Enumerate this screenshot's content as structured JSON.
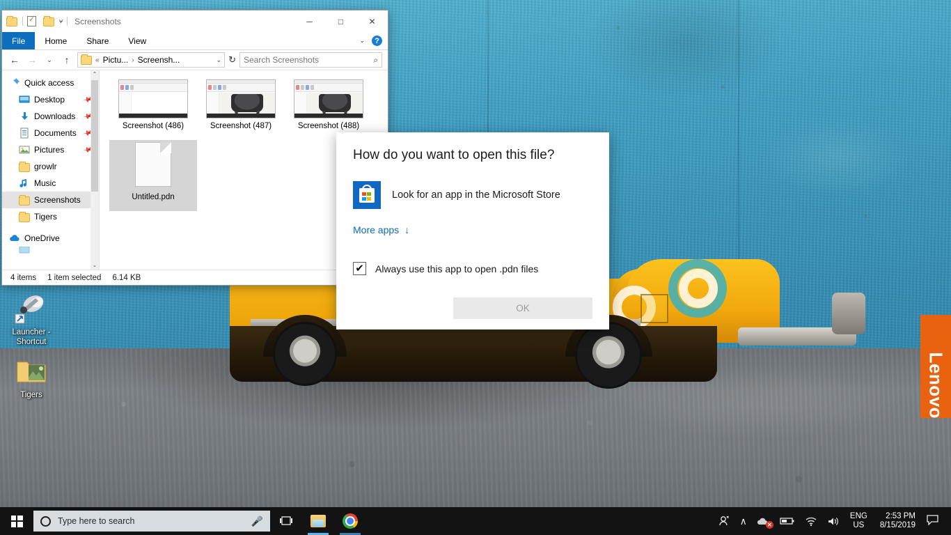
{
  "desktop": {
    "icons": [
      {
        "label": "Launcher - Shortcut",
        "icon": "launcher-shortcut-icon"
      },
      {
        "label": "Tigers",
        "icon": "folder-picture-icon"
      }
    ],
    "lenovo_banner": "Lenovo",
    "wallpaper_colors": {
      "wall": "#3f9fc3",
      "ground": "#7d8286",
      "car": "#f0a80c"
    }
  },
  "explorer": {
    "title": "Screenshots",
    "quick_access_icons": [
      "folder-icon",
      "properties-icon",
      "new-folder-icon",
      "customize-chevron-icon"
    ],
    "window_controls": {
      "minimize": "─",
      "maximize": "□",
      "close": "✕"
    },
    "ribbon": {
      "tabs": [
        "File",
        "Home",
        "Share",
        "View"
      ],
      "collapse": "⌄",
      "help": "?"
    },
    "nav": {
      "back": "←",
      "forward": "→",
      "recent": "⌄",
      "up": "↑",
      "breadcrumb": {
        "prefix": "«",
        "parent": "Pictu...",
        "separator": "›",
        "current": "Screensh...",
        "dropdown": "⌄"
      },
      "refresh": "↻"
    },
    "search": {
      "placeholder": "Search Screenshots",
      "icon": "search-icon"
    },
    "sidebar": [
      {
        "label": "Quick access",
        "icon": "pin-icon",
        "level": 1,
        "pinned": false,
        "selected": false
      },
      {
        "label": "Desktop",
        "icon": "desktop-icon",
        "level": 2,
        "pinned": true,
        "selected": false
      },
      {
        "label": "Downloads",
        "icon": "downloads-icon",
        "level": 2,
        "pinned": true,
        "selected": false
      },
      {
        "label": "Documents",
        "icon": "documents-icon",
        "level": 2,
        "pinned": true,
        "selected": false
      },
      {
        "label": "Pictures",
        "icon": "pictures-icon",
        "level": 2,
        "pinned": true,
        "selected": false
      },
      {
        "label": "growlr",
        "icon": "folder-icon",
        "level": 2,
        "pinned": false,
        "selected": false
      },
      {
        "label": "Music",
        "icon": "music-icon",
        "level": 2,
        "pinned": false,
        "selected": false
      },
      {
        "label": "Screenshots",
        "icon": "folder-icon",
        "level": 2,
        "pinned": false,
        "selected": true
      },
      {
        "label": "Tigers",
        "icon": "folder-icon",
        "level": 2,
        "pinned": false,
        "selected": false
      },
      {
        "label": "OneDrive",
        "icon": "onedrive-icon",
        "level": 1,
        "pinned": false,
        "selected": false
      }
    ],
    "files": [
      {
        "name": "Screenshot (486)",
        "type": "screenshot-blank",
        "selected": false
      },
      {
        "name": "Screenshot (487)",
        "type": "screenshot-grill",
        "selected": false
      },
      {
        "name": "Screenshot (488)",
        "type": "screenshot-grill",
        "selected": false
      },
      {
        "name": "Untitled.pdn",
        "type": "file-generic",
        "selected": true
      }
    ],
    "status": {
      "items": "4 items",
      "selection": "1 item selected",
      "size": "6.14 KB"
    }
  },
  "dialog": {
    "title": "How do you want to open this file?",
    "store_option": {
      "label": "Look for an app in the Microsoft Store",
      "icon": "microsoft-store-icon"
    },
    "more_apps": {
      "label": "More apps",
      "arrow": "↓"
    },
    "checkbox": {
      "label": "Always use this app to open .pdn files",
      "checked": true,
      "mark": "✔"
    },
    "ok_button": {
      "label": "OK",
      "enabled": false
    },
    "link_color": "#0b6bbd"
  },
  "taskbar": {
    "start": "start-button",
    "search": {
      "placeholder": "Type here to search",
      "mic_icon": "microphone-icon"
    },
    "task_view": "⧉",
    "apps": [
      {
        "name": "File Explorer",
        "icon": "file-explorer-icon",
        "state": "active"
      },
      {
        "name": "Google Chrome",
        "icon": "chrome-icon",
        "state": "open"
      }
    ],
    "tray": {
      "people": "⚯",
      "chevron": "∧",
      "onedrive": {
        "icon": "onedrive-icon",
        "badge": "✕"
      },
      "battery": "battery-icon",
      "wifi": "wifi-icon",
      "volume": "🔊",
      "language": {
        "line1": "ENG",
        "line2": "US"
      },
      "clock": {
        "time": "2:53 PM",
        "date": "8/15/2019"
      },
      "action_center": "☐"
    }
  }
}
